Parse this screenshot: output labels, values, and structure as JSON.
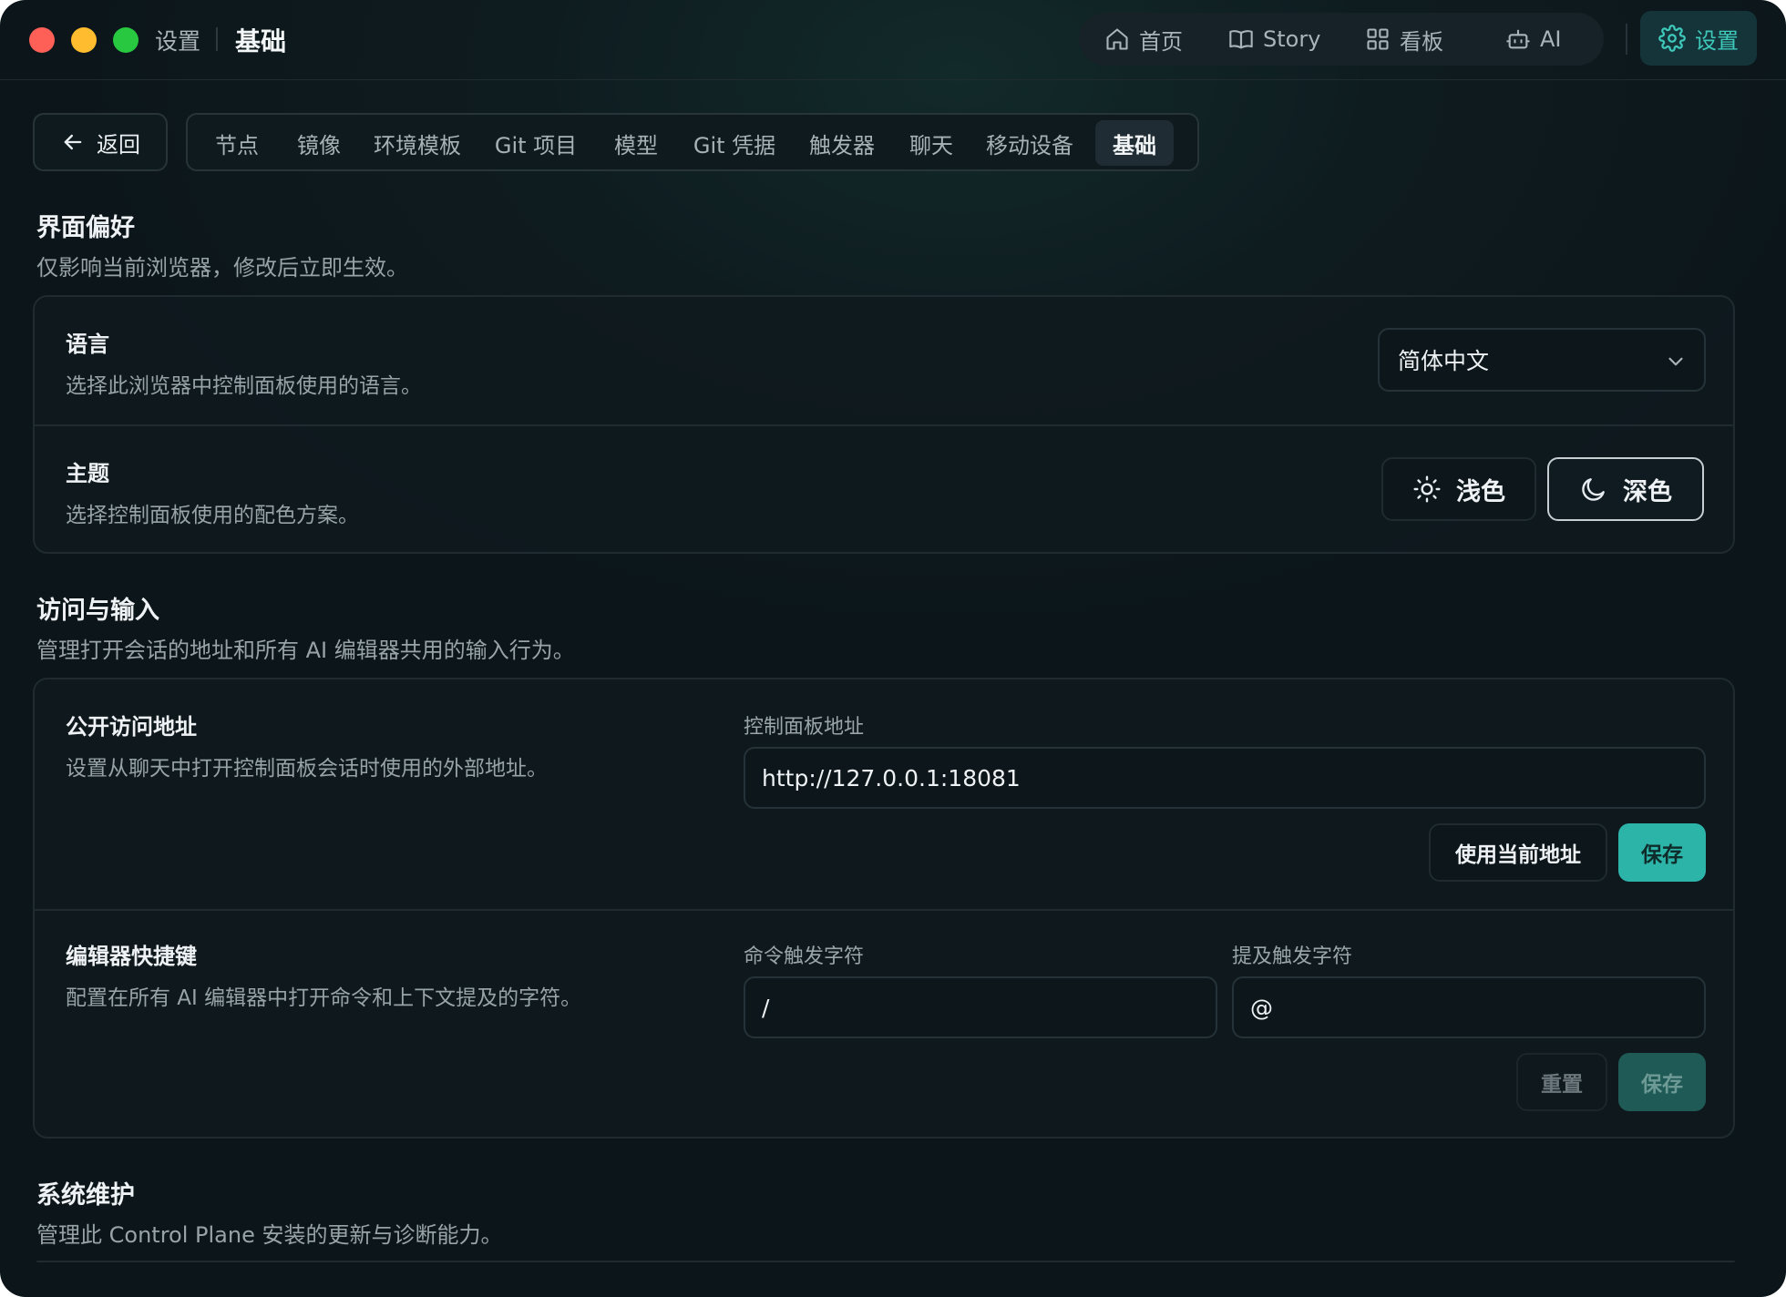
{
  "window": {
    "breadcrumb_parent": "设置",
    "breadcrumb_current": "基础"
  },
  "topnav": {
    "items": [
      {
        "label": "首页",
        "icon": "home-icon"
      },
      {
        "label": "Story",
        "icon": "book-icon"
      },
      {
        "label": "看板",
        "icon": "grid-icon"
      },
      {
        "label": "AI",
        "icon": "bot-icon"
      }
    ],
    "settings_label": "设置",
    "accent_color": "#3ec9bb"
  },
  "subnav": {
    "back_label": "返回",
    "tabs": [
      "节点",
      "镜像",
      "环境模板",
      "Git 项目",
      "模型",
      "Git 凭据",
      "触发器",
      "聊天",
      "移动设备",
      "基础"
    ],
    "active_tab": "基础"
  },
  "ui_prefs": {
    "title": "界面偏好",
    "description": "仅影响当前浏览器，修改后立即生效。",
    "language": {
      "title": "语言",
      "description": "选择此浏览器中控制面板使用的语言。",
      "selected": "简体中文"
    },
    "theme": {
      "title": "主题",
      "description": "选择控制面板使用的配色方案。",
      "light_label": "浅色",
      "dark_label": "深色",
      "selected": "深色"
    }
  },
  "access": {
    "title": "访问与输入",
    "description": "管理打开会话的地址和所有 AI 编辑器共用的输入行为。",
    "public_url": {
      "title": "公开访问地址",
      "description": "设置从聊天中打开控制面板会话时使用的外部地址。",
      "field_label": "控制面板地址",
      "value": "http://127.0.0.1:18081",
      "use_current_label": "使用当前地址",
      "save_label": "保存"
    },
    "shortcuts": {
      "title": "编辑器快捷键",
      "description": "配置在所有 AI 编辑器中打开命令和上下文提及的字符。",
      "command_label": "命令触发字符",
      "command_value": "/",
      "mention_label": "提及触发字符",
      "mention_value": "@",
      "reset_label": "重置",
      "save_label": "保存"
    }
  },
  "maintenance": {
    "title": "系统维护",
    "description": "管理此 Control Plane 安装的更新与诊断能力。"
  }
}
